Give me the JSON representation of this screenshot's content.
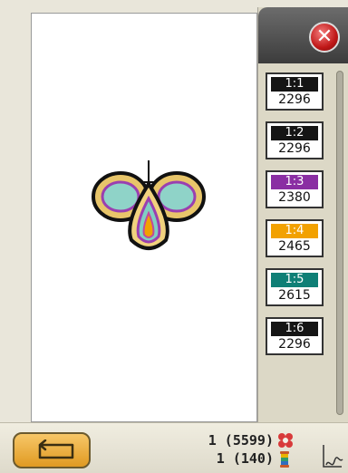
{
  "color_blocks": [
    {
      "label": "1:1",
      "stitches": "2296",
      "color": "#151515"
    },
    {
      "label": "1:2",
      "stitches": "2296",
      "color": "#151515"
    },
    {
      "label": "1:3",
      "stitches": "2380",
      "color": "#8a2ea3"
    },
    {
      "label": "1:4",
      "stitches": "2465",
      "color": "#f2a100"
    },
    {
      "label": "1:5",
      "stitches": "2615",
      "color": "#0f7f76"
    },
    {
      "label": "1:6",
      "stitches": "2296",
      "color": "#151515"
    }
  ],
  "status": {
    "total_stitches": "1 (5599)",
    "total_colors": "1 (140)"
  },
  "icons": {
    "close": "close-icon",
    "back": "back-arrow-icon",
    "stitches": "stitch-count-icon",
    "spool": "thread-spool-icon",
    "hoop": "hoop-icon"
  }
}
